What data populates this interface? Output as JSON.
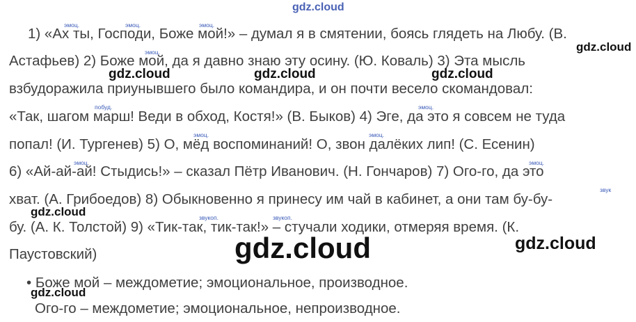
{
  "watermark": "gdz.cloud",
  "annotations": {
    "emots": "эмоц.",
    "pobud": "побуд.",
    "zvuk": "звук",
    "zvukop": "звукоп."
  },
  "lines": {
    "l1": "1) «Ах ты, Господи, Боже мой!» – думал я в смятении, боясь глядеть на Любу. (В.",
    "l2": "Астафьев) 2) Боже мой, да я давно знаю эту осину. (Ю. Коваль) 3) Эта мысль",
    "l3": "взбудоражила приунывшего было командира, и он почти весело скомандовал:",
    "l4": "«Так, шагом марш! Веди в обход, Костя!» (В. Быков) 4) Эге, да это я совсем не туда",
    "l5": "попал! (И. Тургенев) 5) О, мёд воспоминаний! О, звон далёких лип! (С. Есенин)",
    "l6": "6) «Ай-ай-ай! Стыдись!» – сказал Пётр Иванович. (Н. Гончаров) 7) Ого-го, да это",
    "l7": "хват. (А. Грибоедов) 8) Обыкновенно я принесу им чай в кабинет, а они там бу-бу-",
    "l8": "бу. (А. К. Толстой) 9) «Тик-так, тик-так!» – стучали ходики, отмеряя время. (К.",
    "l9": "Паустовский)"
  },
  "bullets": {
    "b1": "• Боже мой – междометие; эмоциональное, производное.",
    "b2": "Ого-го – междометие; эмоциональное, непроизводное."
  }
}
